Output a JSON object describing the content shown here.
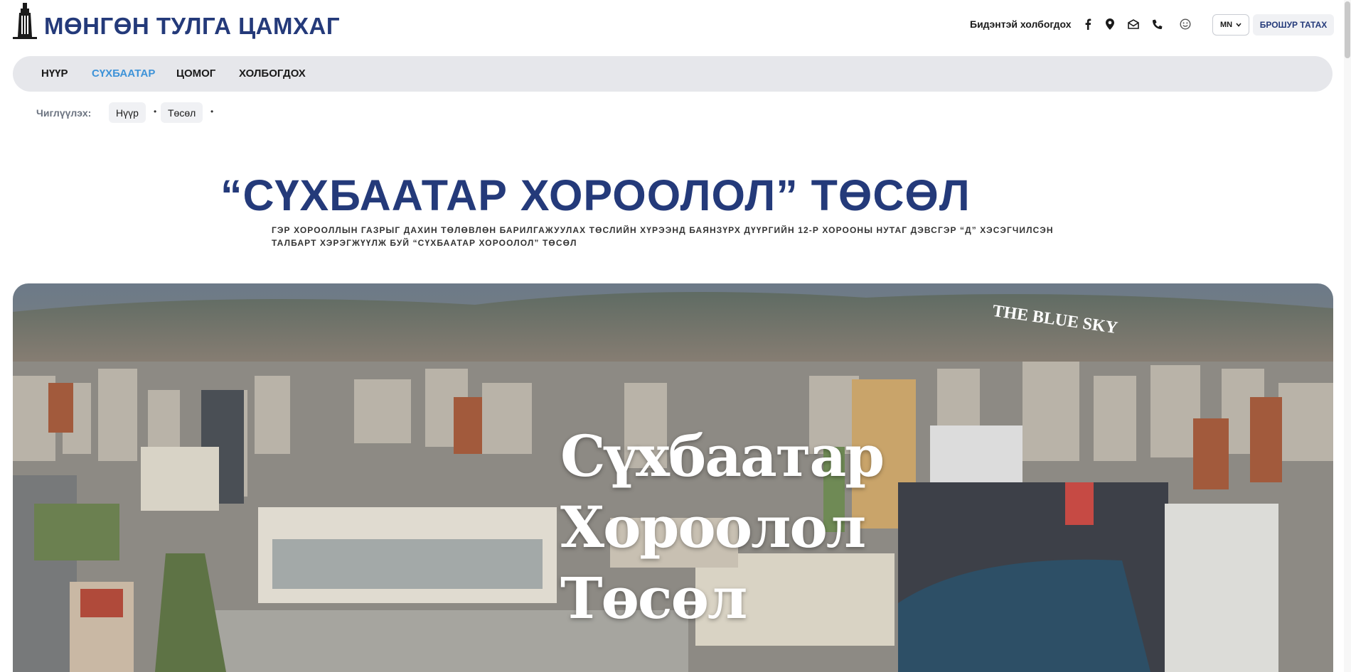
{
  "header": {
    "brand": "МӨНГӨН ТУЛГА ЦАМХАГ",
    "contact_label": "Бидэнтэй холбогдох",
    "contact_icons": [
      "facebook-icon",
      "location-pin-icon",
      "mail-icon",
      "phone-icon",
      "smile-icon"
    ],
    "language": "MN",
    "brochure_button": "БРОШУР ТАТАХ"
  },
  "nav": {
    "items": [
      {
        "label": "НҮҮР",
        "active": false
      },
      {
        "label": "СҮХБААТАР",
        "active": true
      },
      {
        "label": "ЦОМОГ",
        "active": false
      },
      {
        "label": "ХОЛБОГДОХ",
        "active": false
      }
    ],
    "active_color": "#3e93d8"
  },
  "breadcrumb": {
    "label": "Чиглүүлэх:",
    "items": [
      "Нүүр",
      "Төсөл"
    ]
  },
  "page": {
    "title": "“СҮХБААТАР ХОРООЛОЛ” ТӨСӨЛ",
    "subtitle": "ГЭР ХОРООЛЛЫН ГАЗРЫГ ДАХИН ТӨЛӨВЛӨН БАРИЛГАЖУУЛАХ ТӨСЛИЙН ХҮРЭЭНД БАЯНЗҮРХ ДҮҮРГИЙН 12-Р ХОРООНЫ НУТАГ ДЭВСГЭР “Д” ХЭСЭГЧИЛСЭН ТАЛБАРТ ХЭРЭГЖҮҮЛЖ БУЙ “СҮХБААТАР ХОРООЛОЛ” ТӨСӨЛ"
  },
  "hero": {
    "lines": [
      "Сүхбаатар",
      "Хороолол",
      "Төсөл"
    ],
    "building_sign": "THE BLUE SKY"
  },
  "colors": {
    "brand_blue": "#243a7a",
    "nav_bg": "#e6e7eb"
  }
}
